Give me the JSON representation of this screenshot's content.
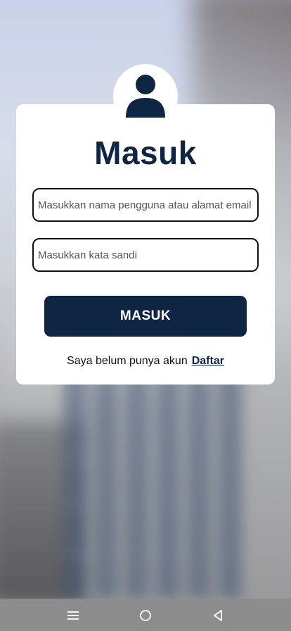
{
  "screen": {
    "title": "Masuk",
    "username_placeholder": "Masukkan nama pengguna atau alamat email",
    "password_placeholder": "Masukkan kata sandi",
    "login_button_label": "MASUK",
    "no_account_text": "Saya belum punya akun",
    "register_link_label": "Daftar"
  },
  "icons": {
    "avatar": "user-icon",
    "nav_menu": "menu-icon",
    "nav_home": "home-icon",
    "nav_back": "back-icon"
  },
  "colors": {
    "primary": "#0e2543",
    "card": "#ffffff",
    "navbar": "#8c8c8c"
  }
}
